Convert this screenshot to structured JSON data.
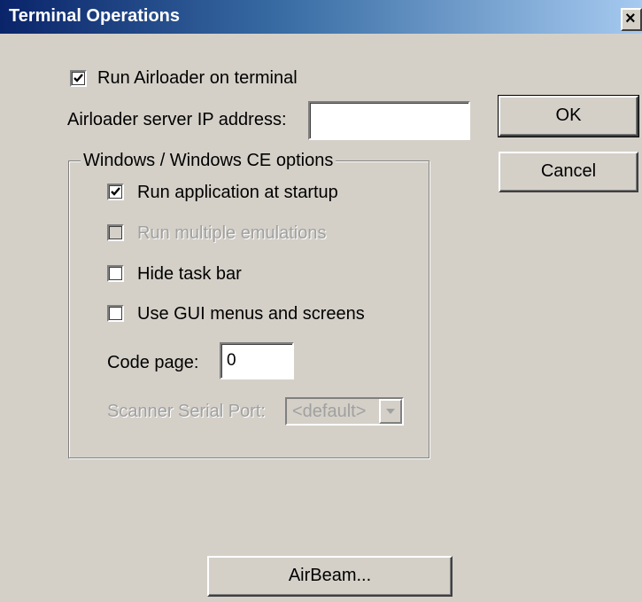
{
  "window": {
    "title": "Terminal Operations",
    "close_symbol": "×"
  },
  "run_airloader": {
    "label": "Run Airloader on terminal",
    "checked": true
  },
  "airloader_ip": {
    "label": "Airloader server IP address:",
    "value": ""
  },
  "buttons": {
    "ok": "OK",
    "cancel": "Cancel",
    "airbeam": "AirBeam..."
  },
  "windows_group": {
    "title": "Windows / Windows CE options",
    "run_app_startup": {
      "label": "Run application at startup",
      "checked": true,
      "enabled": true
    },
    "run_multiple": {
      "label": "Run multiple emulations",
      "checked": false,
      "enabled": false
    },
    "hide_taskbar": {
      "label": "Hide task bar",
      "checked": false,
      "enabled": true
    },
    "gui_menus": {
      "label": "Use GUI menus and screens",
      "checked": false,
      "enabled": true
    },
    "code_page": {
      "label": "Code page:",
      "value": "0"
    },
    "scanner_port": {
      "label": "Scanner Serial Port:",
      "value": "<default>",
      "enabled": false
    }
  },
  "icons": {
    "close": "close-icon",
    "check": "checkmark-icon",
    "dropdown": "chevron-down-icon"
  }
}
